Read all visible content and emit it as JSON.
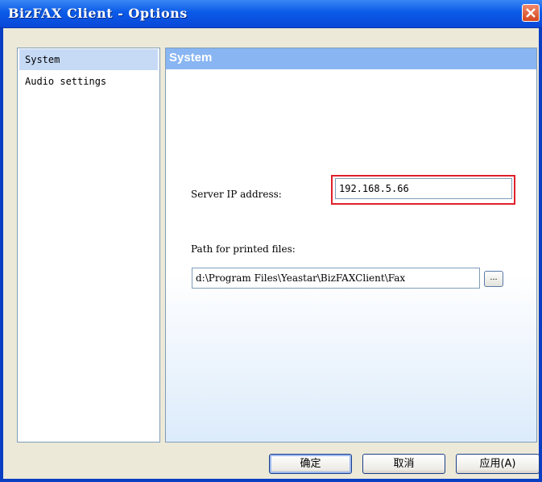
{
  "window": {
    "title": "BizFAX Client - Options",
    "close_glyph": "✕"
  },
  "sidebar": {
    "items": [
      {
        "label": "System",
        "selected": true
      },
      {
        "label": "Audio settings",
        "selected": false
      }
    ]
  },
  "panel": {
    "header": "System",
    "server_ip_label": "Server IP address:",
    "server_ip_value": "192.168.5.66",
    "path_label": "Path for printed files:",
    "path_value": "d:\\Program Files\\Yeastar\\BizFAXClient\\Fax",
    "browse_label": "..."
  },
  "buttons": {
    "ok": "确定",
    "cancel": "取消",
    "apply": "应用(A)"
  },
  "colors": {
    "title_bar": "#0a5ae8",
    "panel_header": "#89b5f2",
    "highlight": "#e0202a"
  }
}
